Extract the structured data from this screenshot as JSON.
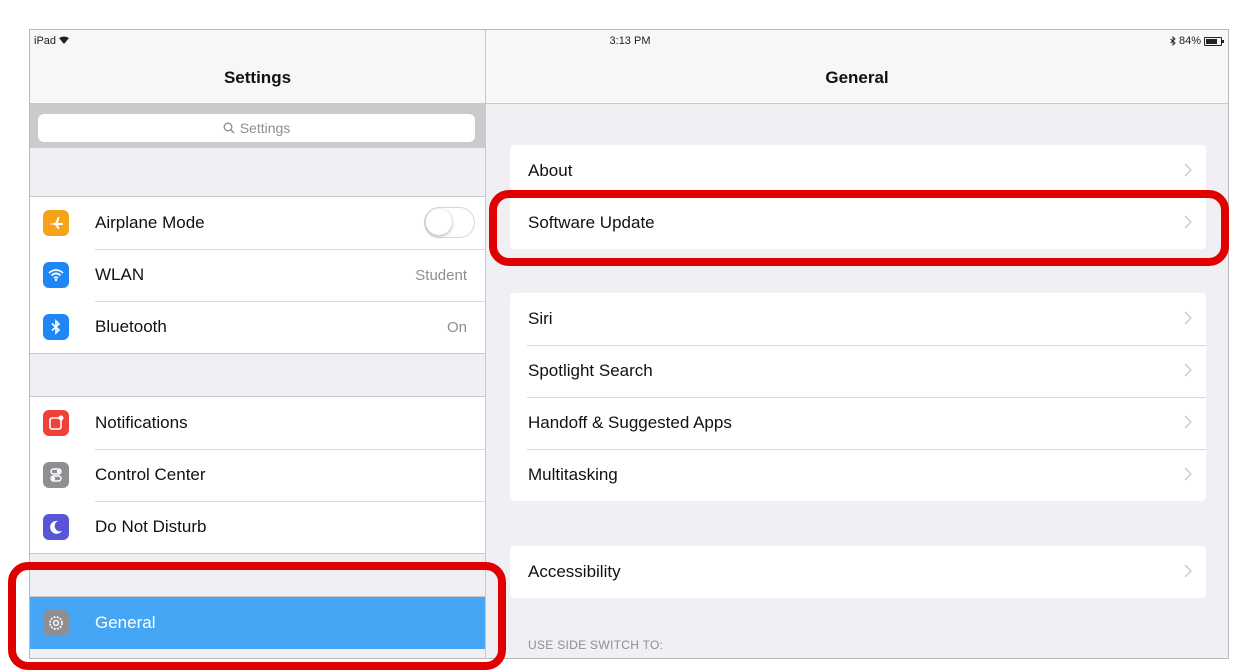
{
  "status_bar": {
    "device": "iPad",
    "time": "3:13 PM",
    "battery": "84%"
  },
  "master": {
    "title": "Settings",
    "search_placeholder": "Settings",
    "group1": [
      {
        "label": "Airplane Mode",
        "icon": "airplane-icon",
        "icon_color": "#f7a21b",
        "control": "toggle",
        "on": false
      },
      {
        "label": "WLAN",
        "icon": "wifi-icon",
        "icon_color": "#1f87f3",
        "value": "Student"
      },
      {
        "label": "Bluetooth",
        "icon": "bluetooth-icon",
        "icon_color": "#1f87f3",
        "value": "On"
      }
    ],
    "group2": [
      {
        "label": "Notifications",
        "icon": "notifications-icon",
        "icon_color": "#f0403a"
      },
      {
        "label": "Control Center",
        "icon": "control-center-icon",
        "icon_color": "#8e8e93"
      },
      {
        "label": "Do Not Disturb",
        "icon": "moon-icon",
        "icon_color": "#5856d6"
      }
    ],
    "group3": [
      {
        "label": "General",
        "icon": "gear-icon",
        "icon_color": "#8e8e93",
        "selected": true
      }
    ],
    "selected_color": "#44a6f5"
  },
  "detail": {
    "title": "General",
    "group1": [
      {
        "label": "About"
      },
      {
        "label": "Software Update"
      }
    ],
    "group2": [
      {
        "label": "Siri"
      },
      {
        "label": "Spotlight Search"
      },
      {
        "label": "Handoff & Suggested Apps"
      },
      {
        "label": "Multitasking"
      }
    ],
    "group3": [
      {
        "label": "Accessibility"
      }
    ],
    "side_switch_header": "USE SIDE SWITCH TO:"
  },
  "annotation_color": "#e00000"
}
